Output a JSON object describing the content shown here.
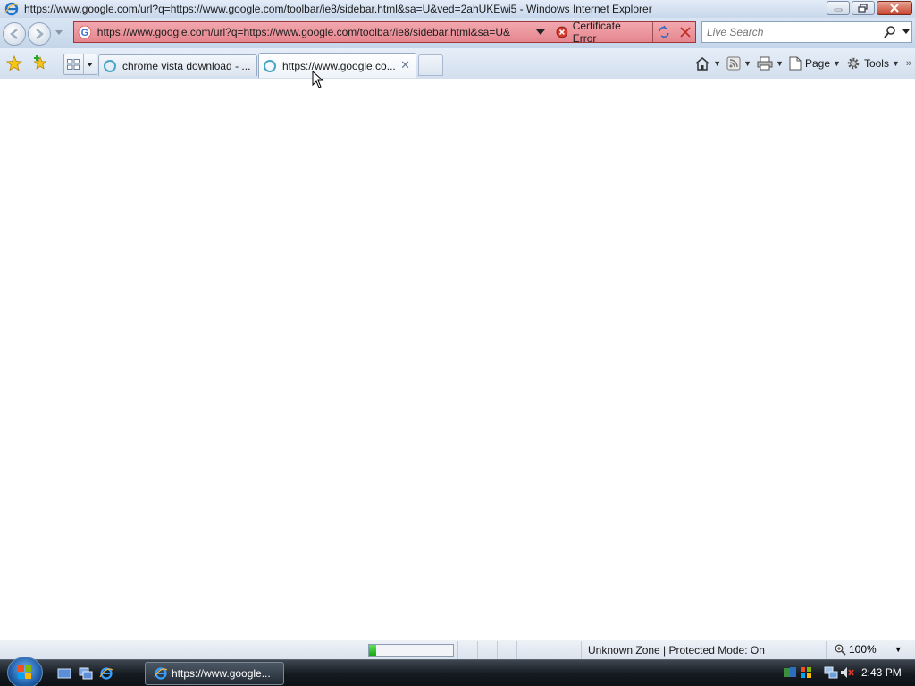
{
  "window": {
    "title": "https://www.google.com/url?q=https://www.google.com/toolbar/ie8/sidebar.html&sa=U&ved=2ahUKEwi5 - Windows Internet Explorer",
    "buttons": {
      "minimize": "minimize-icon",
      "restore": "restore-icon",
      "close": "close-icon"
    }
  },
  "nav": {
    "address": "https://www.google.com/url?q=https://www.google.com/toolbar/ie8/sidebar.html&sa=U&",
    "cert_error": "Certificate Error",
    "search_placeholder": "Live Search"
  },
  "tabs": [
    {
      "label": "chrome vista download - ...",
      "active": false
    },
    {
      "label": "https://www.google.co...",
      "active": true
    }
  ],
  "commands": {
    "page": "Page",
    "tools": "Tools"
  },
  "status": {
    "zone": "Unknown Zone | Protected Mode: On",
    "zoom": "100%",
    "progress": 0.08
  },
  "taskbar": {
    "task_label": "https://www.google...",
    "clock": "2:43 PM"
  },
  "colors": {
    "cert_error_bg": "#e6858e",
    "progress_fill": "#14a80e"
  }
}
